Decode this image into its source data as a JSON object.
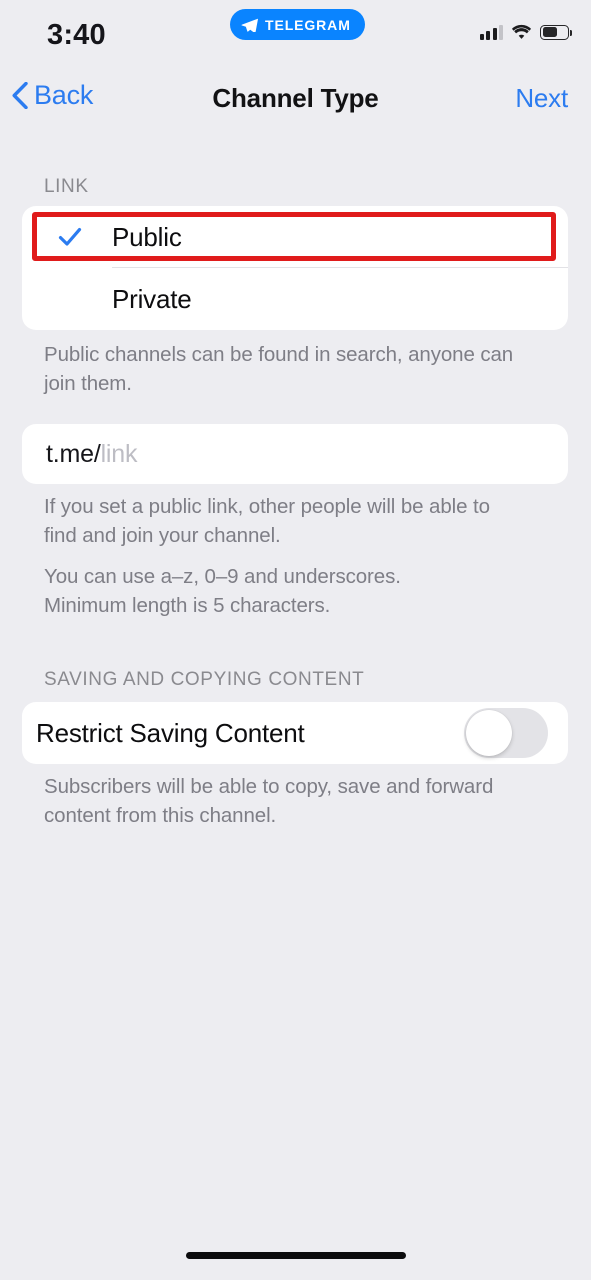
{
  "status_bar": {
    "time": "3:40",
    "app_badge_label": "TELEGRAM",
    "signal_icon": "cellular-signal-icon",
    "wifi_icon": "wifi-icon",
    "battery_icon": "battery-icon",
    "battery_level_percent": 52
  },
  "nav": {
    "back_label": "Back",
    "title": "Channel Type",
    "next_label": "Next",
    "accent_color": "#2c7cf0"
  },
  "link_section": {
    "header": "LINK",
    "options": [
      {
        "label": "Public",
        "selected": true
      },
      {
        "label": "Private",
        "selected": false
      }
    ],
    "footnote": "Public channels can be found in search, anyone can join them.",
    "checkmark_color": "#2c7cf0"
  },
  "link_field": {
    "prefix": "t.me/",
    "placeholder": "link",
    "value": ""
  },
  "link_help": {
    "paragraph_1": "If you set a public link, other people will be able to find and join your channel.",
    "paragraph_2_line_1": "You can use a–z, 0–9 and underscores.",
    "paragraph_2_line_2": "Minimum length is 5 characters."
  },
  "saving_section": {
    "header": "SAVING AND COPYING CONTENT",
    "row_label": "Restrict Saving Content",
    "toggle_on": false,
    "footnote": "Subscribers will be able to copy, save and forward content from this channel."
  },
  "annotation": {
    "highlight_color": "#e01b1b",
    "target": "Public"
  },
  "theme": {
    "page_background": "#ededf1",
    "card_background": "#ffffff",
    "secondary_text": "#8a8a8f"
  }
}
